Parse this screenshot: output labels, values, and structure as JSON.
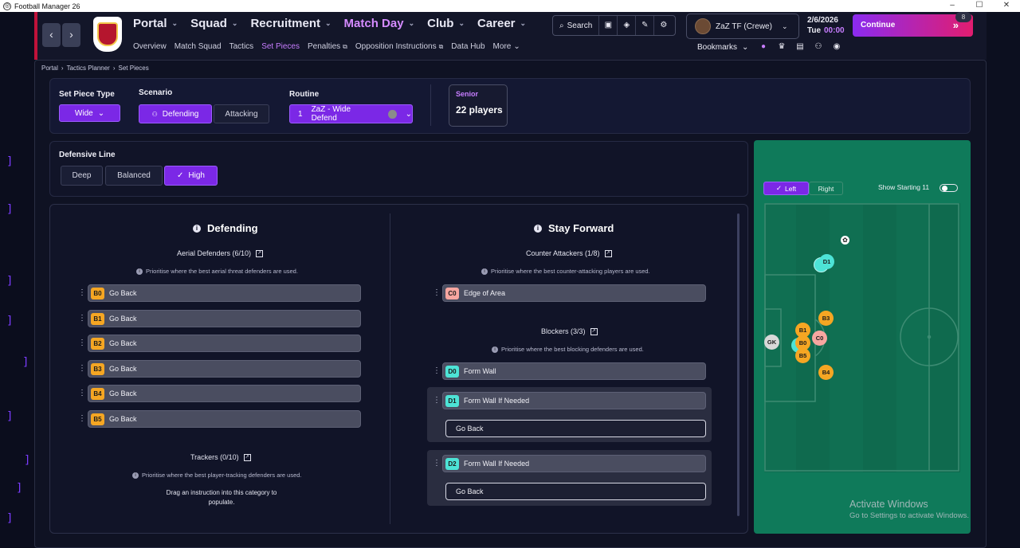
{
  "window": {
    "title": "Football Manager 26",
    "controls": [
      "–",
      "☐",
      "✕"
    ]
  },
  "header": {
    "main_nav": [
      {
        "label": "Portal",
        "active": false
      },
      {
        "label": "Squad",
        "active": false
      },
      {
        "label": "Recruitment",
        "active": false
      },
      {
        "label": "Match Day",
        "active": true
      },
      {
        "label": "Club",
        "active": false
      },
      {
        "label": "Career",
        "active": false
      }
    ],
    "sub_nav": [
      "Overview",
      "Match Squad",
      "Tactics",
      "Set Pieces",
      "Penalties",
      "Opposition Instructions",
      "Data Hub",
      "More"
    ],
    "sub_nav_active": "Set Pieces",
    "search_label": "Search",
    "manager_name": "ZaZ TF (Crewe)",
    "date": "2/6/2026",
    "day": "Tue",
    "time": "00:00",
    "continue_label": "Continue",
    "notification_count": "8",
    "bookmarks_label": "Bookmarks"
  },
  "breadcrumb": [
    "Portal",
    "Tactics Planner",
    "Set Pieces"
  ],
  "setup": {
    "set_piece_type_label": "Set Piece Type",
    "set_piece_type_value": "Wide",
    "scenario_label": "Scenario",
    "scenario_options": [
      "Defending",
      "Attacking"
    ],
    "scenario_selected": "Defending",
    "routine_label": "Routine",
    "routine_number": "1",
    "routine_value": "ZaZ - Wide Defend",
    "squad_label": "Senior",
    "squad_count": "22 players"
  },
  "defensive_line": {
    "label": "Defensive Line",
    "options": [
      "Deep",
      "Balanced",
      "High"
    ],
    "selected": "High"
  },
  "defending": {
    "title": "Defending",
    "aerial_header": "Aerial Defenders (6/10)",
    "aerial_hint": "Prioritise where the best aerial threat defenders are used.",
    "aerial_rows": [
      {
        "code": "B0",
        "label": "Go Back"
      },
      {
        "code": "B1",
        "label": "Go Back"
      },
      {
        "code": "B2",
        "label": "Go Back"
      },
      {
        "code": "B3",
        "label": "Go Back"
      },
      {
        "code": "B4",
        "label": "Go Back"
      },
      {
        "code": "B5",
        "label": "Go Back"
      }
    ],
    "trackers_header": "Trackers (0/10)",
    "trackers_hint": "Prioritise where the best player-tracking defenders are used.",
    "trackers_empty": "Drag an instruction into this category to populate."
  },
  "stay_forward": {
    "title": "Stay Forward",
    "counter_header": "Counter Attackers (1/8)",
    "counter_hint": "Prioritise where the best counter-attacking players are used.",
    "counter_rows": [
      {
        "code": "C0",
        "label": "Edge of Area"
      }
    ],
    "blockers_header": "Blockers (3/3)",
    "blockers_hint": "Prioritise where the best blocking defenders are used.",
    "blocker_rows": [
      {
        "code": "D0",
        "label": "Form Wall"
      },
      {
        "code": "D1",
        "label": "Form Wall If Needed",
        "fallback": "Go Back"
      },
      {
        "code": "D2",
        "label": "Form Wall If Needed",
        "fallback": "Go Back"
      }
    ]
  },
  "pitch": {
    "side_options": [
      "Left",
      "Right"
    ],
    "side_selected": "Left",
    "show_starting_label": "Show Starting 11",
    "show_starting_on": false,
    "players": [
      "D1",
      "B3",
      "B1",
      "C0",
      "B0",
      "B5",
      "B4",
      "GK"
    ]
  },
  "colors": {
    "accent": "#7b28e6",
    "aerial_chip": "#f5a623",
    "counter_chip": "#f7a6a0",
    "blocker_chip": "#4de3d6",
    "pitch": "#0f7a5a"
  },
  "watermark": {
    "line1": "Activate Windows",
    "line2": "Go to Settings to activate Windows."
  }
}
